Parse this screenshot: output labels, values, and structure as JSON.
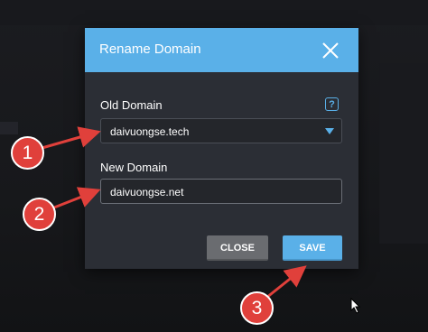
{
  "dialog": {
    "title": "Rename Domain",
    "old_domain_label": "Old Domain",
    "help_label": "?",
    "old_domain_value": "daivuongse.tech",
    "new_domain_label": "New Domain",
    "new_domain_value": "daivuongse.net",
    "close_label": "CLOSE",
    "save_label": "SAVE"
  },
  "annotations": {
    "step1": "1",
    "step2": "2",
    "step3": "3"
  },
  "colors": {
    "accent": "#5ab0e8",
    "badge": "#e0403b",
    "dialog_bg": "#2b2e35"
  }
}
